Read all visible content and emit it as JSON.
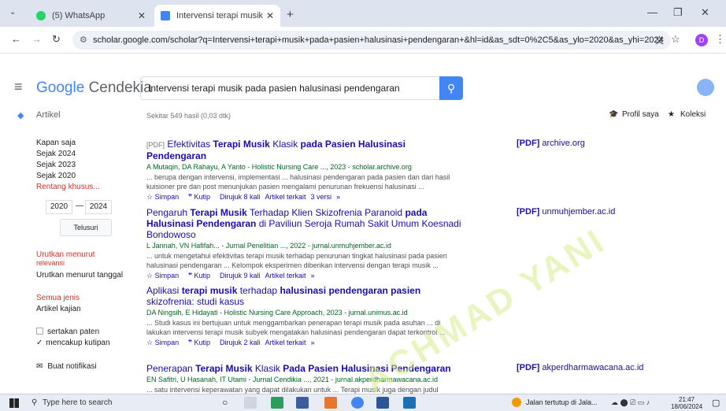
{
  "browser": {
    "tabs": [
      {
        "title": "(5) WhatsApp",
        "color": "#25d366"
      },
      {
        "title": "Intervensi terapi musik pada pa",
        "color": "#4285f4"
      }
    ],
    "url": "scholar.google.com/scholar?q=Intervensi+terapi+musik+pada+pasien+halusinasi+pendengaran+&hl=id&as_sdt=0%2C5&as_ylo=2020&as_yhi=2024",
    "profile_initial": "D"
  },
  "header": {
    "logo_google": "Google",
    "logo_suffix": "Cendekia",
    "query": "Intervensi terapi musik pada pasien halusinasi pendengaran"
  },
  "nav": {
    "artikel": "Artikel",
    "count": "Sekitar 549 hasil (0,03 dtk)",
    "profil": "Profil saya",
    "koleksi": "Koleksi"
  },
  "sidebar": {
    "kapan": "Kapan saja",
    "y2024": "Sejak 2024",
    "y2023": "Sejak 2023",
    "y2020": "Sejak 2020",
    "rentang": "Rentang khusus...",
    "from": "2020",
    "to": "2024",
    "telusuri": "Telusuri",
    "urut1": "Urutkan menurut",
    "urut1b": "relevansi",
    "urut2": "Urutkan menurut tanggal",
    "jenis": "Semua jenis",
    "kajian": "Artikel kajian",
    "paten": "sertakan paten",
    "kutipan": "mencakup kutipan",
    "notif": "Buat notifikasi"
  },
  "results": [
    {
      "tag": "[PDF]",
      "t1": "Efektivitas ",
      "t2": "Terapi Musik",
      "t3": " Klasik ",
      "t4": "pada Pasien Halusinasi Pendengaran",
      "t5": "",
      "t6": "",
      "source": "A Mutaqin, DA Rahayu, A Yanto - Holistic Nursing Care ..., 2023 - scholar.archive.org",
      "snippet": "... berupa dengan intervensi, implementasi ... halusinasi pendengaran pada pasien dan dari hasil kuisioner pre dan post menunjukan pasien mengalami penurunan frekuensi halusinasi ...",
      "simpan": "Simpan",
      "kutip": "Kutip",
      "cited": "Dirujuk 8 kali",
      "related": "Artikel terkait",
      "versions": "3 versi",
      "pdf": "archive.org"
    },
    {
      "tag": "",
      "t1": "Pengaruh ",
      "t2": "Terapi Musik",
      "t3": " Terhadap Klien Skizofrenia Paranoid ",
      "t4": "pada Halusinasi Pendengaran",
      "t5": " di Paviliun Seroja Rumah Sakit Umum Koesnadi Bondowoso",
      "t6": "",
      "source": "L Jannah, VN Hafifah... - Jurnal Penelitian ..., 2022 - jurnal.unmuhjember.ac.id",
      "snippet": "... untuk mengetahui efektivitas terapi musik terhadap penurunan tingkat halusinasi pada pasien halusinasi pendengaran ... Kelompok eksperimen diberikan intervensi dengan terapi musik ...",
      "simpan": "Simpan",
      "kutip": "Kutip",
      "cited": "Dirujuk 9 kali",
      "related": "Artikel terkait",
      "versions": "",
      "pdf": "unmuhjember.ac.id"
    },
    {
      "tag": "",
      "t1": "Aplikasi ",
      "t2": "terapi musik",
      "t3": " terhadap ",
      "t4": "halusinasi pendengaran pasien",
      "t5": " skizofrenia: studi kasus",
      "t6": "",
      "source": "DA Ningsih, E Hidayati - Holistic Nursing Care Approach, 2023 - jurnal.unimus.ac.id",
      "snippet": "... Studi kasus ini bertujuan untuk menggambarkan penerapan terapi musik pada asuhan ... di lakukan intervensi terapi musik subyek mengatakan halusinasi pendengaran dapat terkontrol ...",
      "simpan": "Simpan",
      "kutip": "Kutip",
      "cited": "Dirujuk 2 kali",
      "related": "Artikel terkait",
      "versions": "",
      "pdf": ""
    },
    {
      "tag": "",
      "t1": "Penerapan ",
      "t2": "Terapi Musik",
      "t3": " Klasik ",
      "t4": "Pada Pasien Halusinasi Pendengaran",
      "t5": "",
      "t6": "",
      "source": "EN Safitri, U Hasanah, IT Utami - Jurnal Cendikia ..., 2021 - jurnal.akperdharmawacana.ac.id",
      "snippet": "... satu intervensi keperawatan yang dapat dilakukan untuk ... Terapi musik juga dengan judul",
      "simpan": "",
      "kutip": "",
      "cited": "",
      "related": "",
      "versions": "",
      "pdf": "akperdharmawacana.ac.id"
    }
  ],
  "watermark": "ACHMAD YANI",
  "taskbar": {
    "search": "Type here to search",
    "tray_text": "Jalan tertutup di Jala...",
    "time": "21:47",
    "date": "18/06/2024"
  }
}
